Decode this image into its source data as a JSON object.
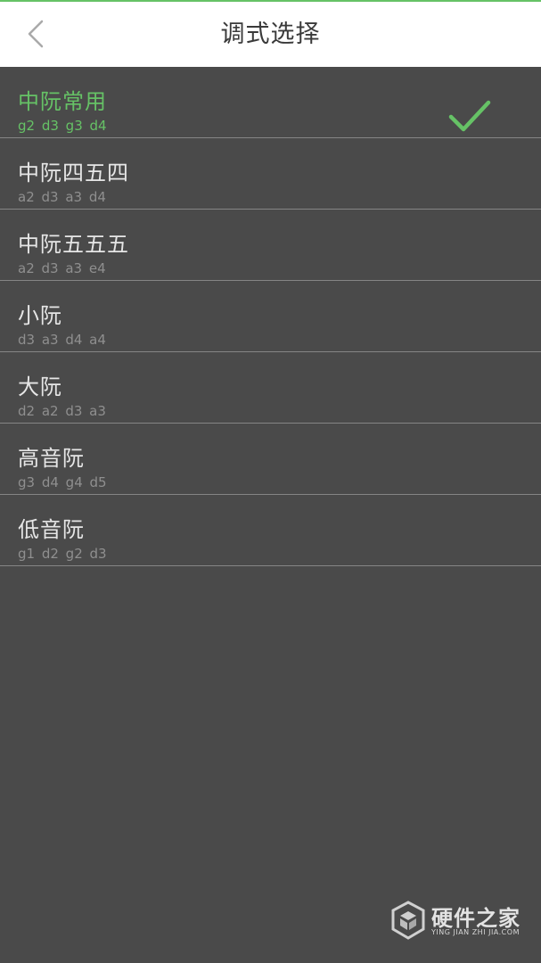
{
  "header": {
    "title": "调式选择",
    "back_icon": "chevron-left-icon"
  },
  "tunings": [
    {
      "name": "中阮常用",
      "notes": "g2 d3 g3 d4",
      "selected": true
    },
    {
      "name": "中阮四五四",
      "notes": "a2 d3 a3 d4",
      "selected": false
    },
    {
      "name": "中阮五五五",
      "notes": "a2 d3 a3 e4",
      "selected": false
    },
    {
      "name": "小阮",
      "notes": "d3 a3 d4 a4",
      "selected": false
    },
    {
      "name": "大阮",
      "notes": "d2 a2 d3 a3",
      "selected": false
    },
    {
      "name": "高音阮",
      "notes": "g3 d4 g4 d5",
      "selected": false
    },
    {
      "name": "低音阮",
      "notes": "g1 d2 g2 d3",
      "selected": false
    }
  ],
  "watermark": {
    "title": "硬件之家",
    "subtitle": "YING JIAN ZHI JIA.COM"
  },
  "colors": {
    "accent": "#66c266",
    "background": "#4a4a4a",
    "header_bg": "#ffffff"
  }
}
